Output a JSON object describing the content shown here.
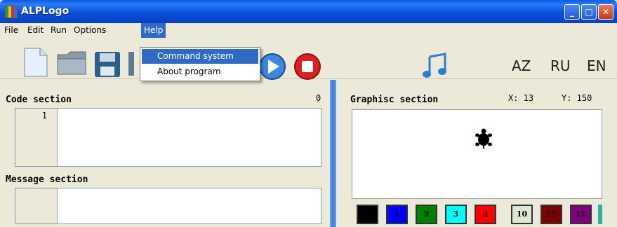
{
  "window": {
    "title": "ALPLogo"
  },
  "menu": {
    "file": "File",
    "edit": "Edit",
    "run": "Run",
    "options": "Options",
    "help": "Help"
  },
  "help_menu": {
    "items": [
      "Command system",
      "About program"
    ],
    "highlighted": "Command system"
  },
  "toolbar": {
    "icons": [
      "new-file-icon",
      "open-folder-icon",
      "save-icon",
      "run-icon",
      "stop-icon",
      "music-icon"
    ],
    "languages": [
      "AZ",
      "RU",
      "EN"
    ]
  },
  "code_section": {
    "label": "Code section",
    "counter": "0",
    "line_numbers": [
      "1"
    ]
  },
  "message_section": {
    "label": "Message section"
  },
  "graphics_section": {
    "label": "Graphisc section",
    "x_readout": "X: 13",
    "y_readout": "Y: 150"
  },
  "palette": {
    "swatches": [
      {
        "label": "",
        "color": "#000000"
      },
      {
        "label": "1",
        "color": "#0000ff"
      },
      {
        "label": "2",
        "color": "#008000"
      },
      {
        "label": "3",
        "color": "#00ffff"
      },
      {
        "label": "4",
        "color": "#ff0000"
      },
      {
        "label": "10",
        "color": "#dde8d0"
      },
      {
        "label": "11",
        "color": "#800000"
      },
      {
        "label": "12",
        "color": "#800080"
      }
    ]
  }
}
